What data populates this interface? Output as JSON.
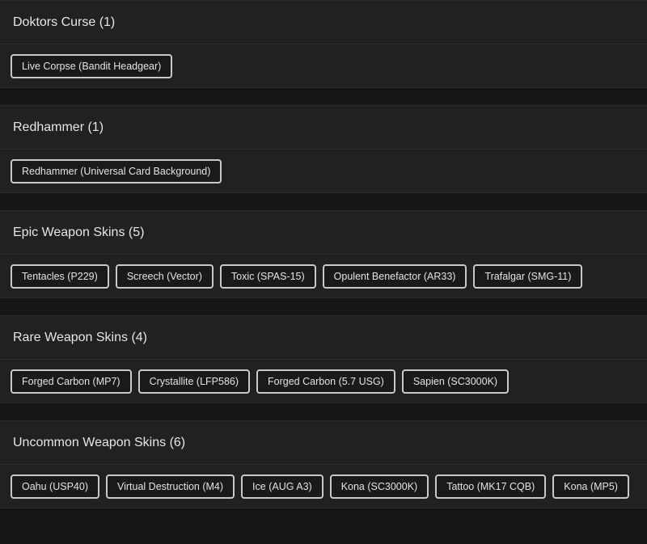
{
  "sections": [
    {
      "title": "Doktors Curse (1)",
      "items": [
        "Live Corpse (Bandit Headgear)"
      ]
    },
    {
      "title": "Redhammer (1)",
      "items": [
        "Redhammer (Universal Card Background)"
      ]
    },
    {
      "title": "Epic Weapon Skins (5)",
      "items": [
        "Tentacles (P229)",
        "Screech (Vector)",
        "Toxic (SPAS-15)",
        "Opulent Benefactor (AR33)",
        "Trafalgar (SMG-11)"
      ]
    },
    {
      "title": "Rare Weapon Skins (4)",
      "items": [
        "Forged Carbon (MP7)",
        "Crystallite (LFP586)",
        "Forged Carbon (5.7 USG)",
        "Sapien (SC3000K)"
      ]
    },
    {
      "title": "Uncommon Weapon Skins (6)",
      "items": [
        "Oahu (USP40)",
        "Virtual Destruction (M4)",
        "Ice (AUG A3)",
        "Kona (SC3000K)",
        "Tattoo (MK17 CQB)",
        "Kona (MP5)"
      ]
    }
  ]
}
